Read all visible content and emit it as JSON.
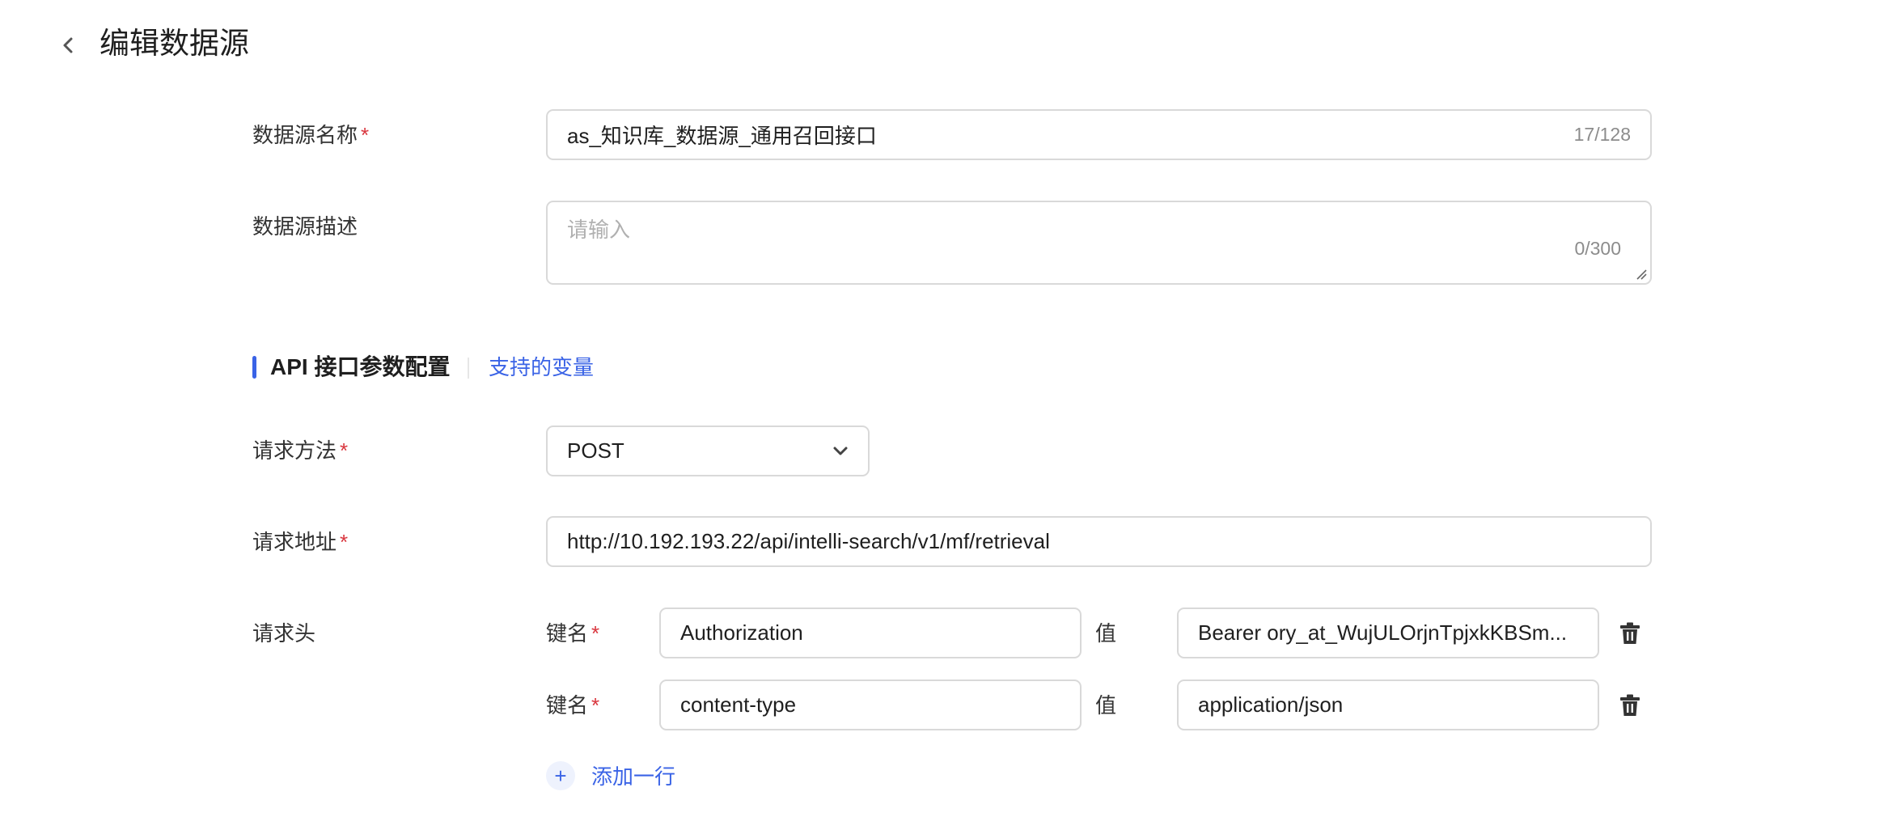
{
  "header": {
    "title": "编辑数据源"
  },
  "form": {
    "name": {
      "label": "数据源名称",
      "value": "as_知识库_数据源_通用召回接口",
      "counter": "17/128"
    },
    "description": {
      "label": "数据源描述",
      "placeholder": "请输入",
      "counter": "0/300"
    }
  },
  "section": {
    "title": "API 接口参数配置",
    "link": "支持的变量"
  },
  "method": {
    "label": "请求方法",
    "value": "POST"
  },
  "url": {
    "label": "请求地址",
    "value": "http://10.192.193.22/api/intelli-search/v1/mf/retrieval"
  },
  "headers": {
    "label": "请求头",
    "key_label": "键名",
    "value_label": "值",
    "rows": [
      {
        "key": "Authorization",
        "value": "Bearer ory_at_WujULOrjnTpjxkKBSm..."
      },
      {
        "key": "content-type",
        "value": "application/json"
      }
    ],
    "add_label": "添加一行"
  },
  "required_mark": "*",
  "colors": {
    "accent": "#3a63e6",
    "required": "#d9363e",
    "border": "#d9d9d9"
  }
}
